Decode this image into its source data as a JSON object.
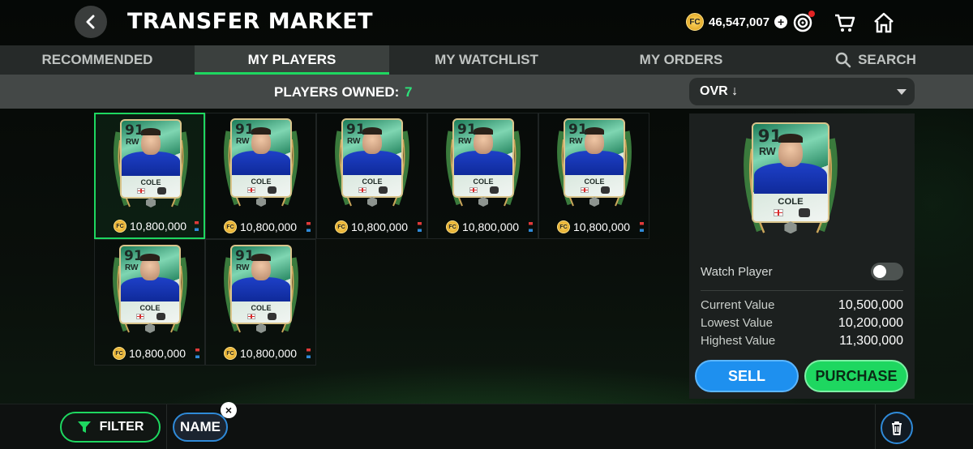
{
  "header": {
    "title": "TRANSFER MARKET",
    "coins": "46,547,007",
    "coin_icon": "fc-coin-icon",
    "icons": [
      "back-arrow-icon",
      "add-coins-icon",
      "objectives-target-icon",
      "cart-icon",
      "home-icon"
    ]
  },
  "tabs": [
    {
      "label": "RECOMMENDED",
      "active": false
    },
    {
      "label": "MY PLAYERS",
      "active": true
    },
    {
      "label": "MY WATCHLIST",
      "active": false
    },
    {
      "label": "MY ORDERS",
      "active": false
    },
    {
      "label": "SEARCH",
      "active": false,
      "icon": "search-icon"
    }
  ],
  "subbar": {
    "owned_label": "PLAYERS OWNED:",
    "owned_count": "7",
    "sort_value": "OVR ↓"
  },
  "players": [
    {
      "ovr": "91",
      "pos": "RW",
      "name": "COLE",
      "price": "10,800,000",
      "selected": true
    },
    {
      "ovr": "91",
      "pos": "RW",
      "name": "COLE",
      "price": "10,800,000",
      "selected": false
    },
    {
      "ovr": "91",
      "pos": "RW",
      "name": "COLE",
      "price": "10,800,000",
      "selected": false
    },
    {
      "ovr": "91",
      "pos": "RW",
      "name": "COLE",
      "price": "10,800,000",
      "selected": false
    },
    {
      "ovr": "91",
      "pos": "RW",
      "name": "COLE",
      "price": "10,800,000",
      "selected": false
    },
    {
      "ovr": "91",
      "pos": "RW",
      "name": "COLE",
      "price": "10,800,000",
      "selected": false
    },
    {
      "ovr": "91",
      "pos": "RW",
      "name": "COLE",
      "price": "10,800,000",
      "selected": false
    }
  ],
  "detail": {
    "ovr": "91",
    "pos": "RW",
    "name": "COLE",
    "watch_label": "Watch Player",
    "watching": false,
    "current_label": "Current Value",
    "current_value": "10,500,000",
    "lowest_label": "Lowest Value",
    "lowest_value": "10,200,000",
    "highest_label": "Highest Value",
    "highest_value": "11,300,000",
    "sell_label": "SELL",
    "purchase_label": "PURCHASE"
  },
  "bottom": {
    "filter_label": "FILTER",
    "chip_label": "NAME"
  },
  "colors": {
    "accent_green": "#1ed760",
    "accent_blue": "#1e90ef",
    "coin_gold": "#f2b632"
  }
}
